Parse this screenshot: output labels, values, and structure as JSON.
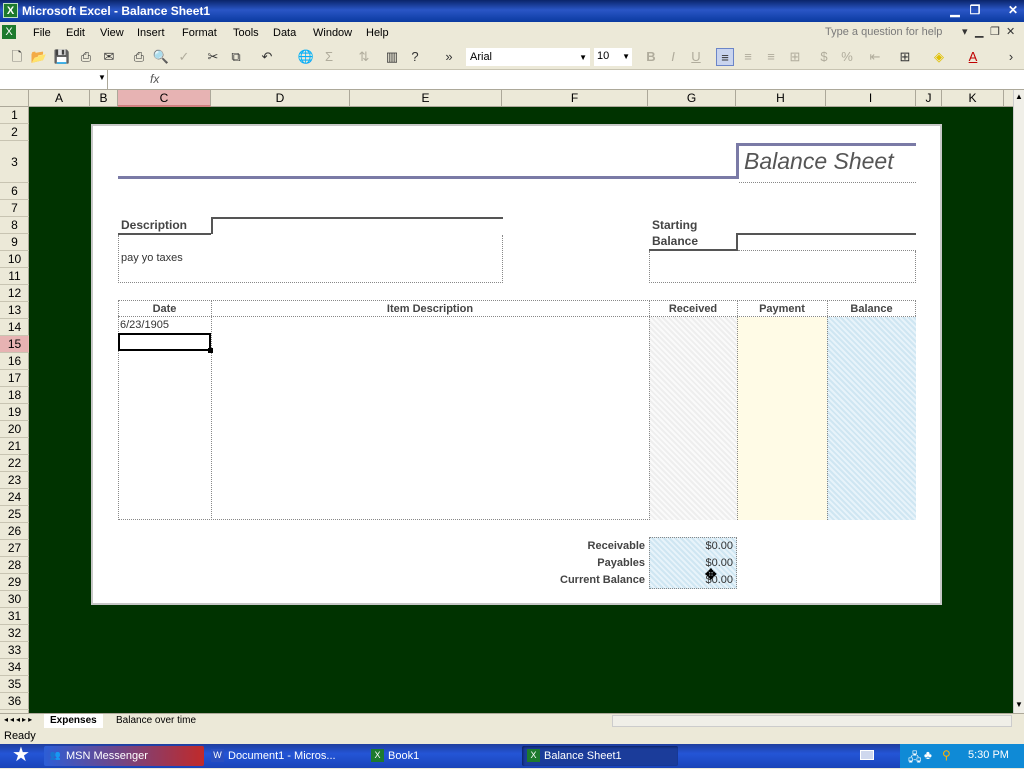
{
  "window": {
    "title": "Microsoft Excel - Balance Sheet1"
  },
  "menu": [
    "File",
    "Edit",
    "View",
    "Insert",
    "Format",
    "Tools",
    "Data",
    "Window",
    "Help"
  ],
  "help_placeholder": "Type a question for help",
  "toolbar": {
    "font": "Arial",
    "size": "10"
  },
  "columns": [
    "A",
    "B",
    "C",
    "D",
    "E",
    "F",
    "G",
    "H",
    "I",
    "J",
    "K"
  ],
  "rows": [
    "1",
    "2",
    "3",
    "6",
    "7",
    "8",
    "9",
    "10",
    "11",
    "12",
    "13",
    "14",
    "15",
    "16",
    "17",
    "18",
    "19",
    "20",
    "21",
    "22",
    "23",
    "24",
    "25",
    "26",
    "27",
    "28",
    "29",
    "30",
    "31",
    "32",
    "33",
    "34",
    "35",
    "36"
  ],
  "sheet": {
    "title": "Balance Sheet",
    "description_label": "Description",
    "description_value": "pay yo taxes",
    "starting_label_1": "Starting",
    "starting_label_2": "Balance",
    "headers": {
      "date": "Date",
      "item": "Item Description",
      "received": "Received",
      "payment": "Payment",
      "balance": "Balance"
    },
    "first_date": "6/23/1905",
    "summary": {
      "receivable_label": "Receivable",
      "receivable_value": "$0.00",
      "payables_label": "Payables",
      "payables_value": "$0.00",
      "current_label": "Current Balance",
      "current_value": "$0.00"
    }
  },
  "tabs": [
    "Expenses",
    "Balance over time"
  ],
  "status": "Ready",
  "taskbar": {
    "items": [
      "MSN Messenger",
      "Document1 - Micros...",
      "Book1",
      "Balance Sheet1"
    ],
    "clock": "5:30 PM"
  }
}
